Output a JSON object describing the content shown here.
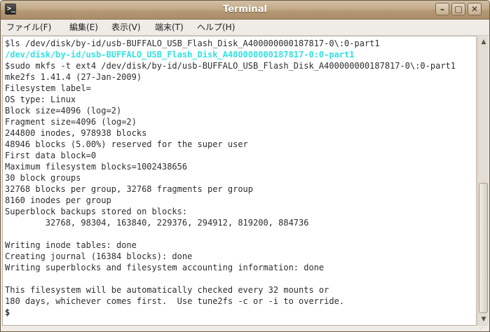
{
  "window": {
    "title": "Terminal",
    "icon_glyph": ">_",
    "controls": {
      "minimize_glyph": "–",
      "maximize_glyph": "□",
      "close_glyph": "✕"
    }
  },
  "menubar": {
    "items": [
      {
        "label": "ファイル(F)"
      },
      {
        "label": "編集(E)"
      },
      {
        "label": "表示(V)"
      },
      {
        "label": "端末(T)"
      },
      {
        "label": "ヘルプ(H)"
      }
    ]
  },
  "terminal": {
    "colors": {
      "background": "#ffffff",
      "foreground": "#2e2e2e",
      "link": "#34e2e2"
    },
    "lines": [
      {
        "text": "$ls /dev/disk/by-id/usb-BUFFALO_USB_Flash_Disk_A400000000187817-0\\:0-part1",
        "style": "normal"
      },
      {
        "text": "/dev/disk/by-id/usb-BUFFALO_USB_Flash_Disk_A400000000187817-0:0-part1",
        "style": "link"
      },
      {
        "text": "$sudo mkfs -t ext4 /dev/disk/by-id/usb-BUFFALO_USB_Flash_Disk_A400000000187817-0\\:0-part1",
        "style": "normal"
      },
      {
        "text": "mke2fs 1.41.4 (27-Jan-2009)",
        "style": "normal"
      },
      {
        "text": "Filesystem label=",
        "style": "normal"
      },
      {
        "text": "OS type: Linux",
        "style": "normal"
      },
      {
        "text": "Block size=4096 (log=2)",
        "style": "normal"
      },
      {
        "text": "Fragment size=4096 (log=2)",
        "style": "normal"
      },
      {
        "text": "244800 inodes, 978938 blocks",
        "style": "normal"
      },
      {
        "text": "48946 blocks (5.00%) reserved for the super user",
        "style": "normal"
      },
      {
        "text": "First data block=0",
        "style": "normal"
      },
      {
        "text": "Maximum filesystem blocks=1002438656",
        "style": "normal"
      },
      {
        "text": "30 block groups",
        "style": "normal"
      },
      {
        "text": "32768 blocks per group, 32768 fragments per group",
        "style": "normal"
      },
      {
        "text": "8160 inodes per group",
        "style": "normal"
      },
      {
        "text": "Superblock backups stored on blocks:",
        "style": "normal"
      },
      {
        "text": "        32768, 98304, 163840, 229376, 294912, 819200, 884736",
        "style": "normal"
      },
      {
        "text": "",
        "style": "normal"
      },
      {
        "text": "Writing inode tables: done",
        "style": "normal"
      },
      {
        "text": "Creating journal (16384 blocks): done",
        "style": "normal"
      },
      {
        "text": "Writing superblocks and filesystem accounting information: done",
        "style": "normal"
      },
      {
        "text": "",
        "style": "normal"
      },
      {
        "text": "This filesystem will be automatically checked every 32 mounts or",
        "style": "normal"
      },
      {
        "text": "180 days, whichever comes first.  Use tune2fs -c or -i to override.",
        "style": "normal"
      },
      {
        "text": "$",
        "style": "prompt"
      }
    ]
  },
  "scrollbar": {
    "up_glyph": "▲",
    "down_glyph": "▼",
    "scroll_position": 0.98
  }
}
